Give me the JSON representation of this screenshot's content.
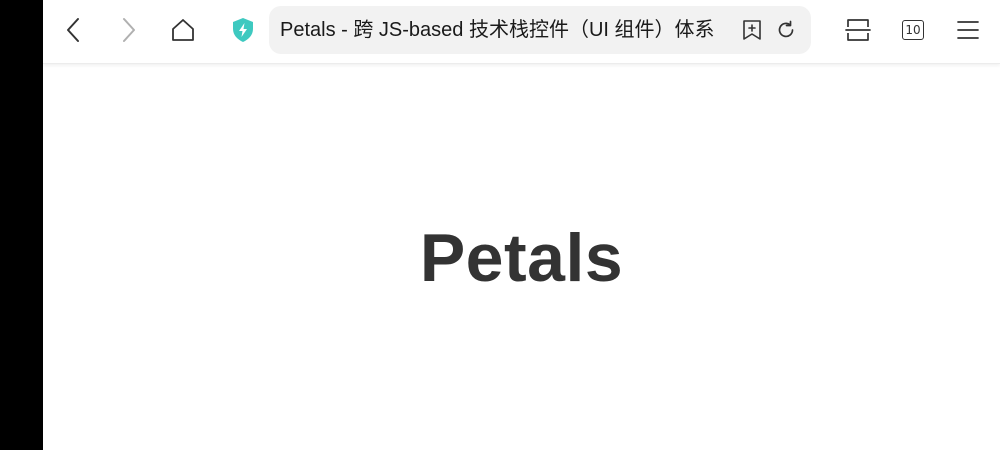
{
  "browser": {
    "address_bar": {
      "title": "Petals - 跨 JS-based 技术栈控件（UI 组件）体系"
    },
    "tab_count": "10",
    "toolbar_icons": [
      "back-icon",
      "forward-icon",
      "home-icon",
      "security-shield-icon",
      "bookmark-add-icon",
      "reload-icon",
      "split-view-icon",
      "tabs-icon",
      "menu-icon"
    ],
    "colors": {
      "shield": "#3ec9c0",
      "icon": "#333333",
      "icon_disabled": "#b0b0b0",
      "address_bg": "#f2f2f2",
      "heading": "#333333"
    }
  },
  "page": {
    "heading": "Petals"
  }
}
